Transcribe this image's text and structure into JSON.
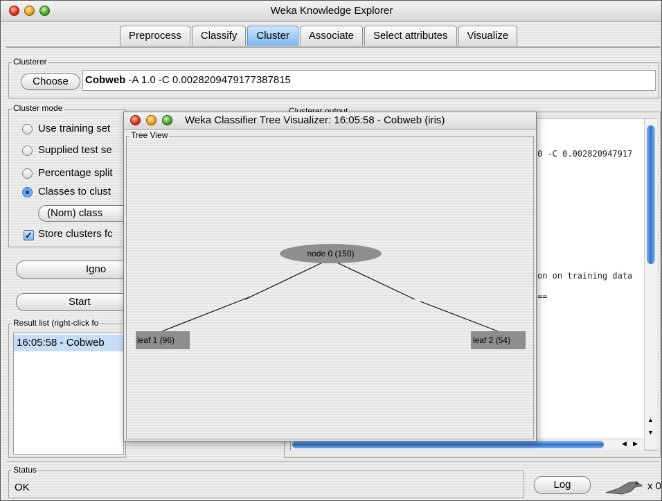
{
  "window": {
    "title": "Weka Knowledge Explorer"
  },
  "tabs": [
    "Preprocess",
    "Classify",
    "Cluster",
    "Associate",
    "Select attributes",
    "Visualize"
  ],
  "active_tab": "Cluster",
  "clusterer": {
    "legend": "Clusterer",
    "choose_label": "Choose",
    "scheme_name": "Cobweb",
    "scheme_options": " -A 1.0 -C 0.0028209479177387815"
  },
  "cluster_mode": {
    "legend": "Cluster mode",
    "options": [
      "Use training set",
      "Supplied test se",
      "Percentage split",
      "Classes to clust"
    ],
    "selected_index": 3,
    "class_select": "(Nom) class",
    "store_clusters_label": "Store clusters fc",
    "store_clusters_checked": true
  },
  "ignore_button": "Igno",
  "start_button": "Start",
  "result_list": {
    "legend": "Result list (right-click fo",
    "items": [
      "16:05:58 - Cobweb"
    ]
  },
  "output": {
    "legend": "Clusterer output",
    "lines": [
      "0 -C 0.002820947917",
      "on on training data",
      "=="
    ]
  },
  "status": {
    "legend": "Status",
    "text": "OK",
    "log_button": "Log",
    "count": "x 0"
  },
  "tree_window": {
    "title": "Weka Classifier Tree Visualizer: 16:05:58 - Cobweb (iris)",
    "legend": "Tree View",
    "root": "node 0  (150)",
    "leaves": [
      "leaf 1  (96)",
      "leaf 2  (54)"
    ]
  },
  "colors": {
    "active_tab": "#7bb6ef",
    "node_fill": "#8e8e8e",
    "selection": "#c7dcf6"
  }
}
